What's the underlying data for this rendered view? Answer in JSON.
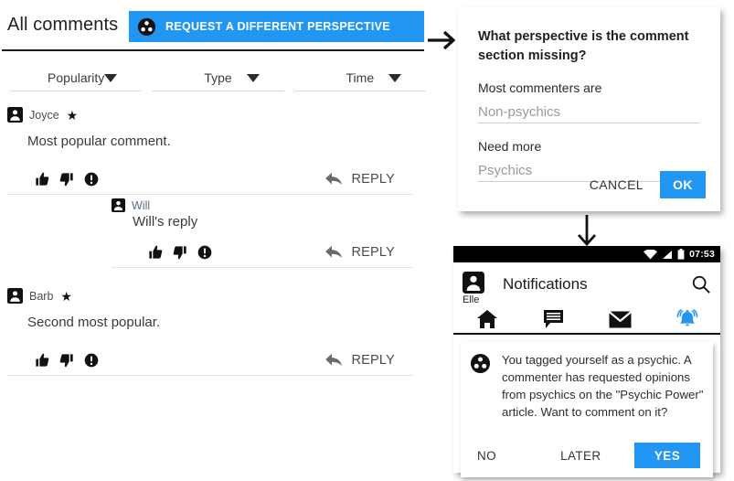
{
  "comments_panel": {
    "title": "All comments",
    "request_button": {
      "label": "REQUEST A DIFFERENT PERSPECTIVE",
      "icon": "perspective-group-icon",
      "color": "#2196f3"
    },
    "filters": [
      {
        "label": "Popularity",
        "icon": "chevron-down-icon"
      },
      {
        "label": "Type",
        "icon": "chevron-down-icon"
      },
      {
        "label": "Time",
        "icon": "chevron-down-icon"
      }
    ],
    "action_labels": {
      "reply": "REPLY",
      "thumbs_up": "thumbs-up-icon",
      "thumbs_down": "thumbs-down-icon",
      "report": "report-icon"
    },
    "comments": [
      {
        "author": "Joyce",
        "badge": "★",
        "body": "Most popular comment.",
        "reply": "REPLY"
      },
      {
        "author": "Will",
        "badge": "",
        "body": "Will's reply",
        "reply": "REPLY"
      },
      {
        "author": "Barb",
        "badge": "★",
        "body": "Second most popular.",
        "reply": "REPLY"
      }
    ]
  },
  "flow": {
    "arrow_right": "arrow-right-icon",
    "arrow_down": "arrow-down-icon"
  },
  "dialog": {
    "title": "What perspective is the comment section missing?",
    "fields": [
      {
        "label": "Most commenters are",
        "value": "",
        "placeholder": "Non-psychics"
      },
      {
        "label": "Need more",
        "value": "",
        "placeholder": "Psychics"
      }
    ],
    "cancel_label": "CANCEL",
    "ok_label": "OK",
    "accent_color": "#2196f3"
  },
  "phone": {
    "statusbar": {
      "clock": "07:53",
      "icons": [
        "wifi-icon",
        "signal-icon",
        "battery-icon"
      ]
    },
    "appbar": {
      "user_name": "Elle",
      "title": "Notifications",
      "search_icon": "search-icon",
      "avatar": "avatar-icon"
    },
    "tabs": [
      {
        "name": "home",
        "icon": "home-icon",
        "active": false
      },
      {
        "name": "comments",
        "icon": "chat-bubble-icon",
        "active": false
      },
      {
        "name": "messages",
        "icon": "envelope-icon",
        "active": false
      },
      {
        "name": "notifications",
        "icon": "bell-icon",
        "active": true
      }
    ],
    "notification": {
      "icon": "perspective-group-icon",
      "text": "You tagged yourself as a psychic. A commenter has requested opinions from psychics on the \"Psychic Power\" article. Want to comment on it?",
      "buttons": {
        "no": "NO",
        "later": "LATER",
        "yes": "YES"
      },
      "accent_color": "#2196f3"
    }
  }
}
